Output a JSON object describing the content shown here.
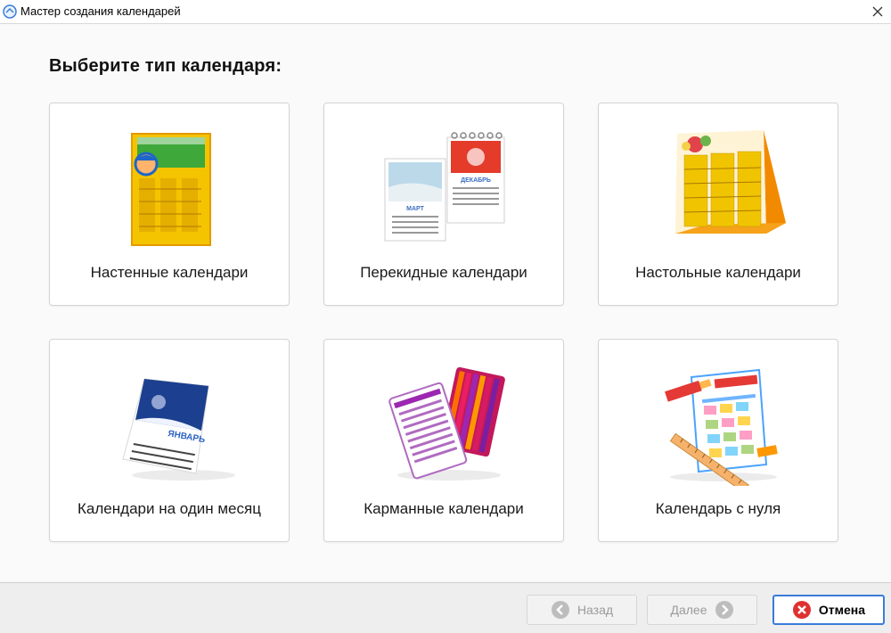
{
  "window": {
    "title": "Мастер создания календарей",
    "app_icon": "app-globe-icon",
    "close_icon": "close-icon"
  },
  "main": {
    "heading": "Выберите тип календаря:",
    "cards": [
      {
        "label": "Настенные календари",
        "icon": "wall-calendar-icon"
      },
      {
        "label": "Перекидные календари",
        "icon": "flip-calendar-icon",
        "month_left": "МАРТ",
        "month_right": "ДЕКАБРЬ"
      },
      {
        "label": "Настольные календари",
        "icon": "desk-calendar-icon"
      },
      {
        "label": "Календари на один месяц",
        "icon": "one-month-calendar-icon",
        "month": "ЯНВАРЬ"
      },
      {
        "label": "Карманные календари",
        "icon": "pocket-calendar-icon"
      },
      {
        "label": "Календарь с нуля",
        "icon": "blank-calendar-icon"
      }
    ]
  },
  "footer": {
    "back_label": "Назад",
    "next_label": "Далее",
    "cancel_label": "Отмена"
  },
  "colors": {
    "accent": "#3b7bd9",
    "cancel_icon": "#e03030"
  }
}
